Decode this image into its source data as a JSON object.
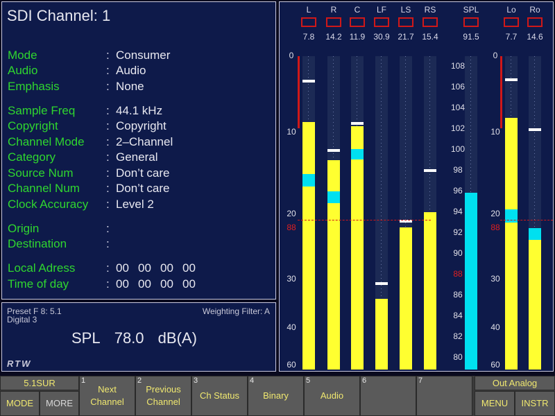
{
  "info": {
    "title": "SDI Channel: 1",
    "fields": [
      {
        "label": "Mode",
        "value": "Consumer"
      },
      {
        "label": "Audio",
        "value": "Audio"
      },
      {
        "label": "Emphasis",
        "value": "None"
      },
      {
        "label": "Sample Freq",
        "value": "44.1 kHz"
      },
      {
        "label": "Copyright",
        "value": "Copyright"
      },
      {
        "label": "Channel Mode",
        "value": "2–Channel"
      },
      {
        "label": "Category",
        "value": "General"
      },
      {
        "label": "Source Num",
        "value": "Don’t care"
      },
      {
        "label": "Channel Num",
        "value": "Don’t care"
      },
      {
        "label": "Clock Accuracy",
        "value": "Level 2"
      },
      {
        "label": "Origin",
        "value": ""
      },
      {
        "label": "Destination",
        "value": ""
      },
      {
        "label": "Local Adress",
        "value": [
          "00",
          "00",
          "00",
          "00"
        ]
      },
      {
        "label": "Time of day",
        "value": [
          "00",
          "00",
          "00",
          "00"
        ]
      }
    ],
    "colon": ":"
  },
  "spl": {
    "preset": "Preset F 8: 5.1",
    "source": "Digital 3",
    "weighting": "Weighting Filter: A",
    "label": "SPL",
    "value": "78.0",
    "unit": "dB(A)",
    "logo": "RTW"
  },
  "meters": {
    "channels": [
      {
        "name": "L",
        "peak": "7.8",
        "level": 0.79,
        "cyan": [
          0.585,
          0.624
        ],
        "hold": 0.915
      },
      {
        "name": "R",
        "peak": "14.2",
        "level": 0.668,
        "cyan": [
          0.53,
          0.568
        ],
        "hold": 0.695
      },
      {
        "name": "C",
        "peak": "11.9",
        "level": 0.777,
        "cyan": [
          0.67,
          0.704
        ],
        "hold": 0.78
      },
      {
        "name": "LF",
        "peak": "30.9",
        "level": 0.226,
        "cyan": null,
        "hold": 0.27
      },
      {
        "name": "LS",
        "peak": "21.7",
        "level": 0.453,
        "cyan": null,
        "hold": 0.468
      },
      {
        "name": "RS",
        "peak": "15.4",
        "level": 0.503,
        "cyan": null,
        "hold": 0.631
      }
    ],
    "spl_channel": {
      "name": "SPL",
      "peak": "91.5",
      "level": 0.565
    },
    "lr_channels": [
      {
        "name": "Lo",
        "peak": "7.7",
        "level": 0.804,
        "cyan": [
          0.47,
          0.51
        ],
        "hold": 0.92
      },
      {
        "name": "Ro",
        "peak": "14.6",
        "level": 0.414,
        "cyan": [
          0.414,
          0.452
        ],
        "hold": 0.76
      }
    ],
    "left_scale": [
      "0",
      "10",
      "20",
      "88",
      "30",
      "40",
      "60"
    ],
    "spl_scale": [
      "108",
      "106",
      "104",
      "102",
      "100",
      "98",
      "96",
      "94",
      "92",
      "90",
      "88",
      "86",
      "84",
      "82",
      "80"
    ],
    "right_scale": [
      "0",
      "10",
      "20",
      "88",
      "30",
      "40",
      "60"
    ],
    "reference_level": "88",
    "colors": {
      "level": "#ffff30",
      "hold": "#00e0f0",
      "peak_box": "#d01818",
      "reference": "#d01818"
    }
  },
  "toolbar": {
    "mode_top": "5.1SUR",
    "mode": "MODE",
    "more": "MORE",
    "buttons": [
      {
        "num": "1",
        "label": "Next Channel"
      },
      {
        "num": "2",
        "label": "Previous Channel"
      },
      {
        "num": "3",
        "label": "Ch Status"
      },
      {
        "num": "4",
        "label": "Binary"
      },
      {
        "num": "5",
        "label": "Audio"
      },
      {
        "num": "6",
        "label": ""
      },
      {
        "num": "7",
        "label": ""
      }
    ],
    "out_top": "Out Analog",
    "menu": "MENU",
    "instr": "INSTR"
  }
}
